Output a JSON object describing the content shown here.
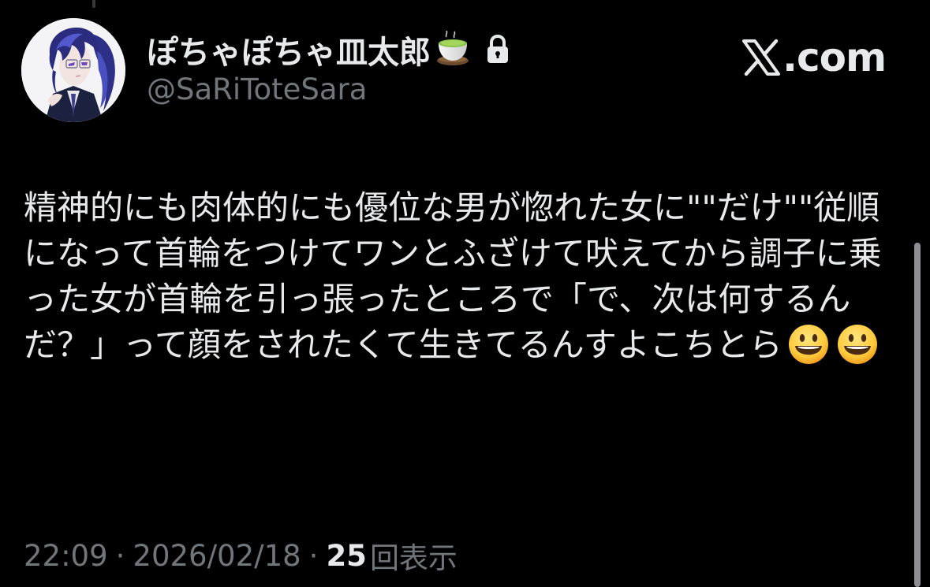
{
  "author": {
    "display_name": "ぽちゃぽちゃ皿太郎",
    "name_emoji": "teacup-icon",
    "handle": "@SaRiToteSara",
    "protected": true
  },
  "brand": {
    "text": ".com",
    "logo": "x-logo-icon"
  },
  "tweet": {
    "text": "精神的にも肉体的にも優位な男が惚れた女に\"\"だけ\"\"従順になって首輪をつけてワンとふざけて吠えてから調子に乗った女が首輪を引っ張ったところで「で、次は何するんだ？」って顔をされたくて生きてるんすよこちとら",
    "emojis": [
      "grinning-face-icon",
      "grinning-face-icon"
    ]
  },
  "meta": {
    "time": "22:09",
    "separator": "·",
    "date": "2026/02/18",
    "views": "25",
    "views_label": "回表示"
  },
  "colors": {
    "background": "#000000",
    "primary_text": "#e7e9ea",
    "secondary_text": "#71767b"
  },
  "scroll": {
    "thumb_position": 0.42
  }
}
